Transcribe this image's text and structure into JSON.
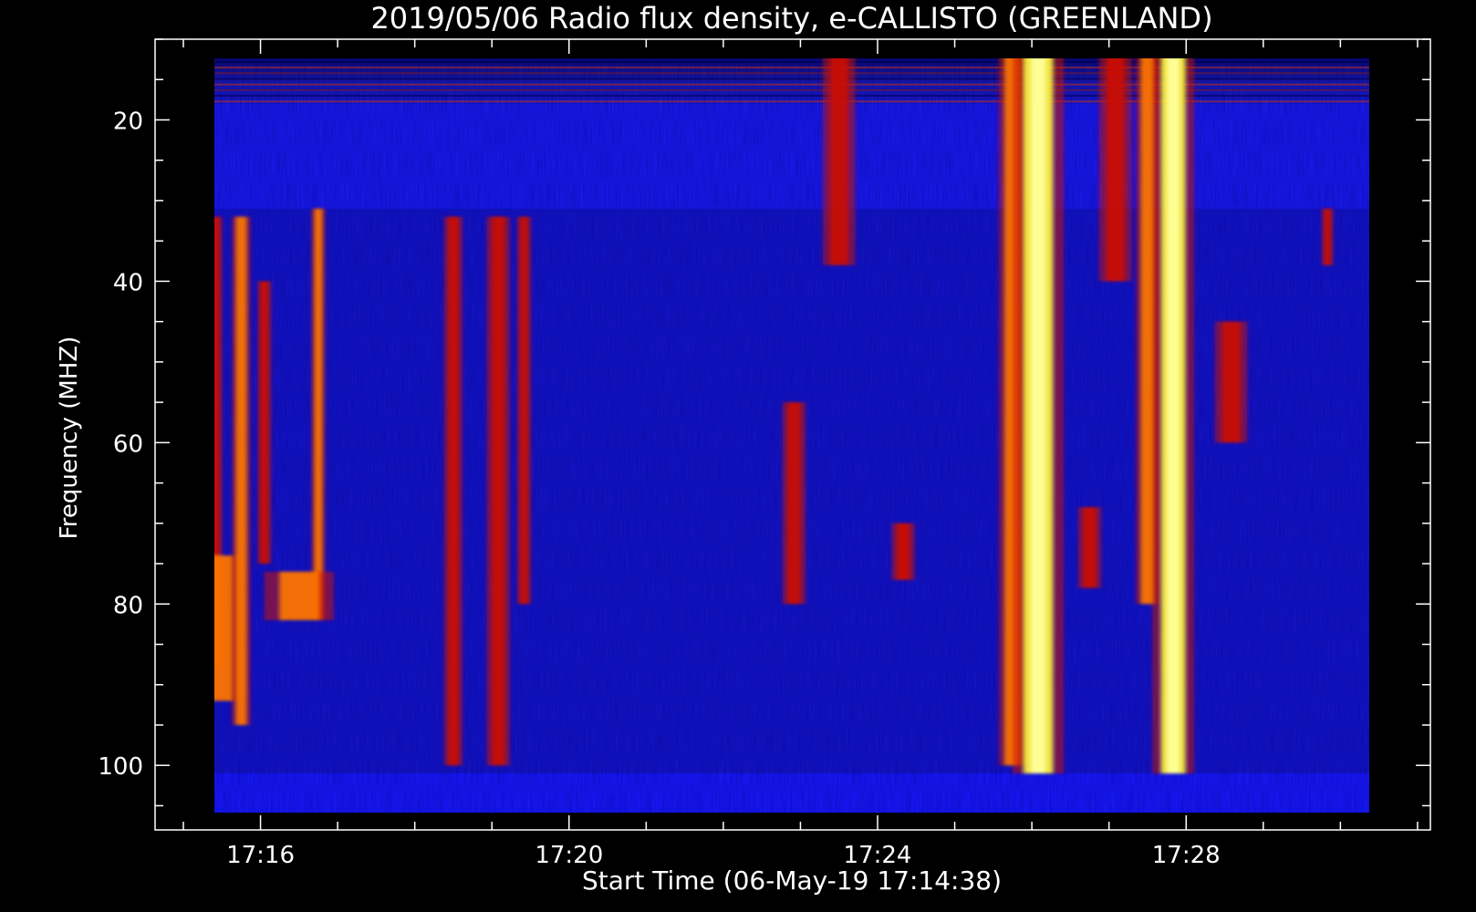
{
  "chart_data": {
    "type": "heatmap",
    "title": "2019/05/06  Radio flux density, e-CALLISTO (GREENLAND)",
    "xlabel": "Start Time (06-May-19 17:14:38)",
    "ylabel": "Frequency (MHZ)",
    "x_range_minutes": [
      "17:14:38",
      "17:31:10"
    ],
    "x_major_ticks": [
      "17:16",
      "17:20",
      "17:24",
      "17:28"
    ],
    "x_minor_tick_step_min": 1,
    "y_range_mhz": [
      10,
      108
    ],
    "y_inverted": true,
    "y_major_ticks": [
      20,
      40,
      60,
      80,
      100
    ],
    "y_minor_tick_step_mhz": 5,
    "data_extent": {
      "time_start": "17:15:00",
      "time_end": "17:30:00",
      "freq_min": 12,
      "freq_max": 106
    },
    "colors": {
      "background": "#000000",
      "low": "#1a1aff",
      "medium": "#cc1100",
      "high": "#ff7a00",
      "peak": "#ffff40"
    },
    "bursts": [
      {
        "time": "17:15:05",
        "f_start": 31,
        "f_end": 100,
        "intensity": 0.95,
        "width_s": 10
      },
      {
        "time": "17:15:25",
        "f_start": 32,
        "f_end": 88,
        "intensity": 0.55,
        "width_s": 6
      },
      {
        "time": "17:15:28",
        "f_start": 74,
        "f_end": 92,
        "intensity": 0.7,
        "width_s": 20
      },
      {
        "time": "17:15:45",
        "f_start": 32,
        "f_end": 95,
        "intensity": 0.8,
        "width_s": 8
      },
      {
        "time": "17:16:03",
        "f_start": 40,
        "f_end": 75,
        "intensity": 0.5,
        "width_s": 6
      },
      {
        "time": "17:16:45",
        "f_start": 31,
        "f_end": 82,
        "intensity": 0.8,
        "width_s": 6
      },
      {
        "time": "17:16:30",
        "f_start": 76,
        "f_end": 82,
        "intensity": 0.7,
        "width_s": 30
      },
      {
        "time": "17:18:30",
        "f_start": 32,
        "f_end": 100,
        "intensity": 0.4,
        "width_s": 8
      },
      {
        "time": "17:19:05",
        "f_start": 32,
        "f_end": 100,
        "intensity": 0.45,
        "width_s": 10
      },
      {
        "time": "17:19:25",
        "f_start": 32,
        "f_end": 80,
        "intensity": 0.5,
        "width_s": 6
      },
      {
        "time": "17:22:55",
        "f_start": 55,
        "f_end": 80,
        "intensity": 0.45,
        "width_s": 10
      },
      {
        "time": "17:23:30",
        "f_start": 12,
        "f_end": 38,
        "intensity": 0.6,
        "width_s": 14
      },
      {
        "time": "17:24:20",
        "f_start": 70,
        "f_end": 77,
        "intensity": 0.6,
        "width_s": 10
      },
      {
        "time": "17:25:45",
        "f_start": 12,
        "f_end": 100,
        "intensity": 0.85,
        "width_s": 12
      },
      {
        "time": "17:26:05",
        "f_start": 12,
        "f_end": 101,
        "intensity": 1.0,
        "width_s": 22
      },
      {
        "time": "17:26:45",
        "f_start": 68,
        "f_end": 78,
        "intensity": 0.5,
        "width_s": 10
      },
      {
        "time": "17:27:05",
        "f_start": 12,
        "f_end": 40,
        "intensity": 0.55,
        "width_s": 14
      },
      {
        "time": "17:27:30",
        "f_start": 12,
        "f_end": 80,
        "intensity": 0.85,
        "width_s": 10
      },
      {
        "time": "17:27:50",
        "f_start": 12,
        "f_end": 101,
        "intensity": 1.0,
        "width_s": 18
      },
      {
        "time": "17:28:35",
        "f_start": 45,
        "f_end": 60,
        "intensity": 0.55,
        "width_s": 14
      },
      {
        "time": "17:29:50",
        "f_start": 31,
        "f_end": 38,
        "intensity": 0.5,
        "width_s": 5
      }
    ]
  }
}
